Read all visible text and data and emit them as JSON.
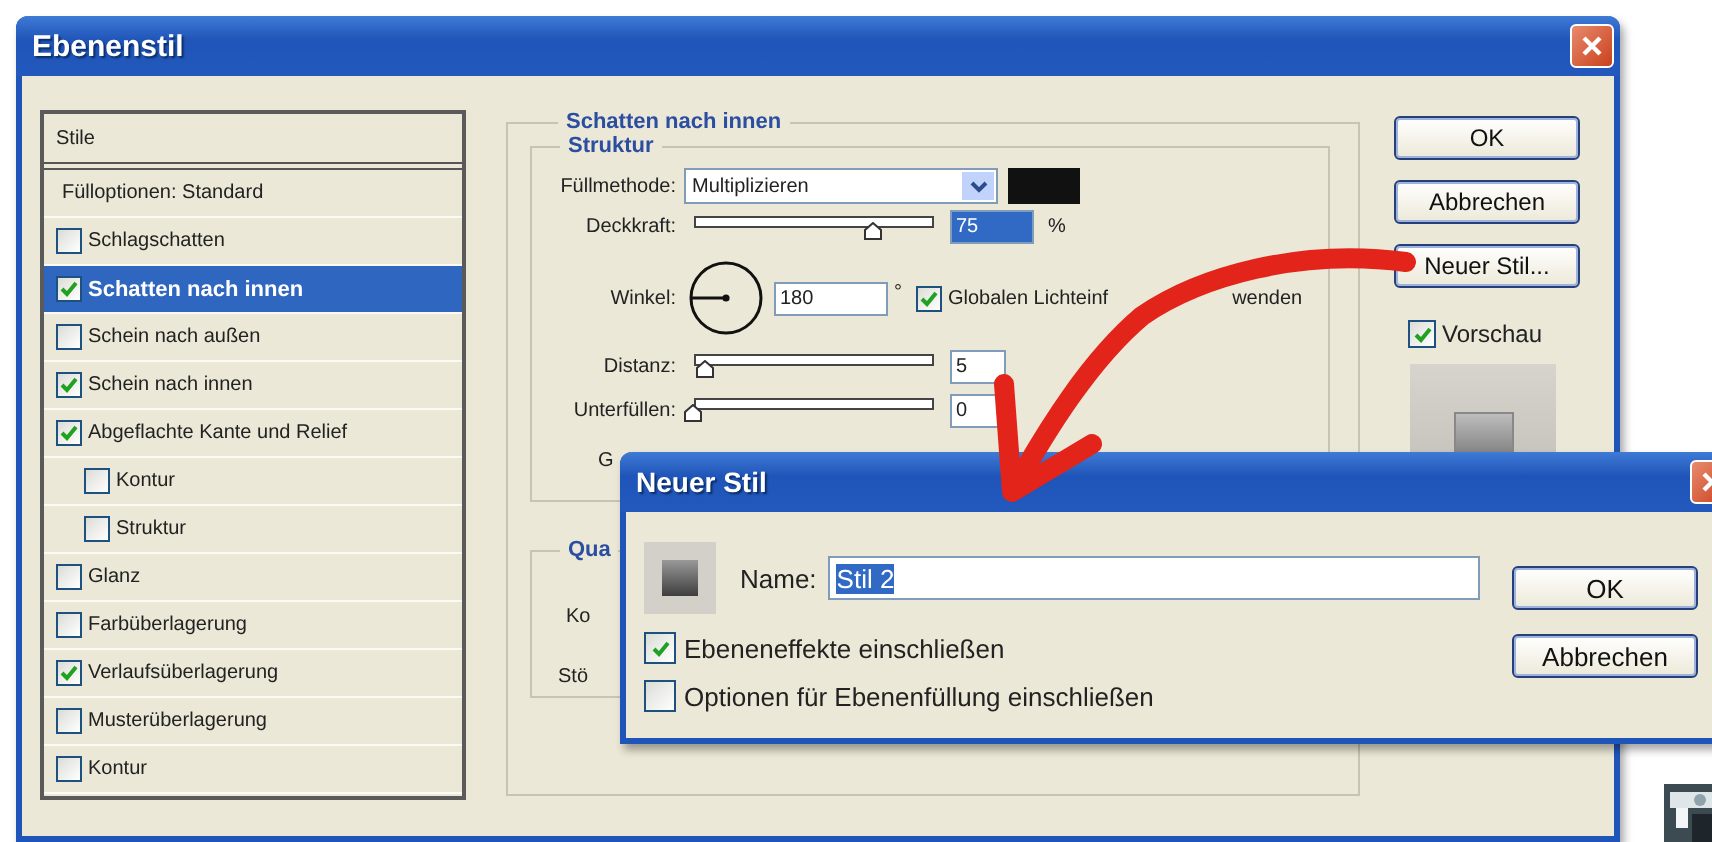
{
  "window": {
    "title": "Ebenenstil"
  },
  "styles_header": "Stile",
  "styles": [
    {
      "label": "Fülloptionen: Standard",
      "kind": "plain",
      "selected": false
    },
    {
      "label": "Schlagschatten",
      "kind": "check",
      "checked": false,
      "selected": false
    },
    {
      "label": "Schatten nach innen",
      "kind": "check",
      "checked": true,
      "selected": true
    },
    {
      "label": "Schein nach außen",
      "kind": "check",
      "checked": false,
      "selected": false
    },
    {
      "label": "Schein nach innen",
      "kind": "check",
      "checked": true,
      "selected": false
    },
    {
      "label": "Abgeflachte Kante und Relief",
      "kind": "check",
      "checked": true,
      "selected": false,
      "children": [
        {
          "label": "Kontur",
          "kind": "check",
          "checked": false,
          "selected": false
        },
        {
          "label": "Struktur",
          "kind": "check",
          "checked": false,
          "selected": false
        }
      ]
    },
    {
      "label": "Glanz",
      "kind": "check",
      "checked": false,
      "selected": false
    },
    {
      "label": "Farbüberlagerung",
      "kind": "check",
      "checked": false,
      "selected": false
    },
    {
      "label": "Verlaufsüberlagerung",
      "kind": "check",
      "checked": true,
      "selected": false
    },
    {
      "label": "Musterüberlagerung",
      "kind": "check",
      "checked": false,
      "selected": false
    },
    {
      "label": "Kontur",
      "kind": "check",
      "checked": false,
      "selected": false
    }
  ],
  "panel": {
    "title": "Schatten nach innen",
    "structure": {
      "title": "Struktur",
      "fill_method": {
        "label": "Füllmethode:",
        "value": "Multiplizieren"
      },
      "opacity": {
        "label": "Deckkraft:",
        "level": 0.75,
        "value": "75",
        "highlighted": true,
        "unit": "%"
      },
      "angle": {
        "label": "Winkel:",
        "value": "180",
        "unit": "°"
      },
      "global_light": {
        "label_start": "Globalen Lichteinf",
        "label_end": "wenden",
        "checked": true
      },
      "distance": {
        "label": "Distanz:",
        "level": 0.05,
        "value": "5"
      },
      "choke": {
        "label": "Unterfüllen:",
        "level": 0,
        "value": "0"
      },
      "size": {
        "label": "G"
      }
    },
    "quality": {
      "title": "Qua",
      "contour_label": "Ko",
      "noise_label": "Stö"
    }
  },
  "buttons": [
    "OK",
    "Abbrechen",
    "Neuer Stil..."
  ],
  "preview": {
    "label": "Vorschau",
    "checked": true
  },
  "new_style_dialog": {
    "title": "Neuer Stil",
    "name_label": "Name:",
    "name_value": "Stil 2",
    "name_highlighted": true,
    "options": [
      {
        "label": "Ebeneneffekte einschließen",
        "checked": true
      },
      {
        "label": "Optionen für Ebenenfüllung einschließen",
        "checked": false
      }
    ],
    "buttons": [
      "OK",
      "Abbrechen"
    ]
  }
}
